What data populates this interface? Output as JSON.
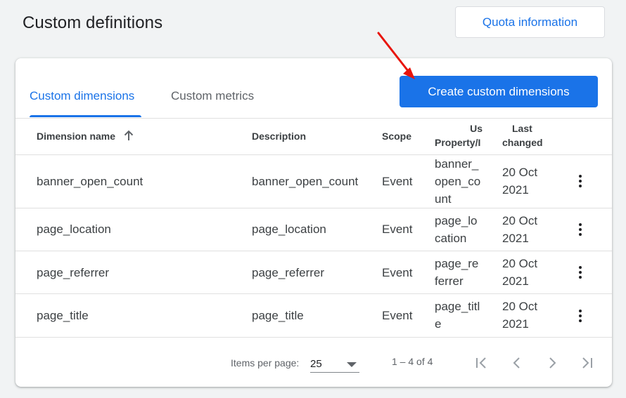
{
  "header": {
    "title": "Custom definitions",
    "quota_button": "Quota information"
  },
  "tabs": [
    {
      "label": "Custom dimensions",
      "active": true
    },
    {
      "label": "Custom metrics",
      "active": false
    }
  ],
  "create_button": "Create custom dimensions",
  "table": {
    "columns": {
      "name": "Dimension name",
      "description": "Description",
      "scope": "Scope",
      "user_property_top": "Us",
      "user_property_bottom": "Property/I",
      "last_changed_line1": "Last",
      "last_changed_line2": "changed"
    },
    "rows": [
      {
        "name": "banner_open_count",
        "description": "banner_open_count",
        "scope": "Event",
        "param_lines": [
          "banner_",
          "open_co",
          "unt"
        ],
        "changed_line1": "20 Oct",
        "changed_line2": "2021"
      },
      {
        "name": "page_location",
        "description": "page_location",
        "scope": "Event",
        "param_lines": [
          "page_lo",
          "cation"
        ],
        "changed_line1": "20 Oct",
        "changed_line2": "2021"
      },
      {
        "name": "page_referrer",
        "description": "page_referrer",
        "scope": "Event",
        "param_lines": [
          "page_re",
          "ferrer"
        ],
        "changed_line1": "20 Oct",
        "changed_line2": "2021"
      },
      {
        "name": "page_title",
        "description": "page_title",
        "scope": "Event",
        "param_lines": [
          "page_titl",
          "e"
        ],
        "changed_line1": "20 Oct",
        "changed_line2": "2021"
      }
    ]
  },
  "pagination": {
    "items_per_page_label": "Items per page:",
    "items_per_page_value": "25",
    "range": "1 – 4 of 4"
  },
  "colors": {
    "accent": "#1a73e8",
    "annotation_arrow": "#e8150c"
  },
  "icons": [
    "sort-up-arrow-icon",
    "more-vert-icon",
    "first-page-icon",
    "previous-page-icon",
    "next-page-icon",
    "last-page-icon",
    "dropdown-caret-icon"
  ]
}
